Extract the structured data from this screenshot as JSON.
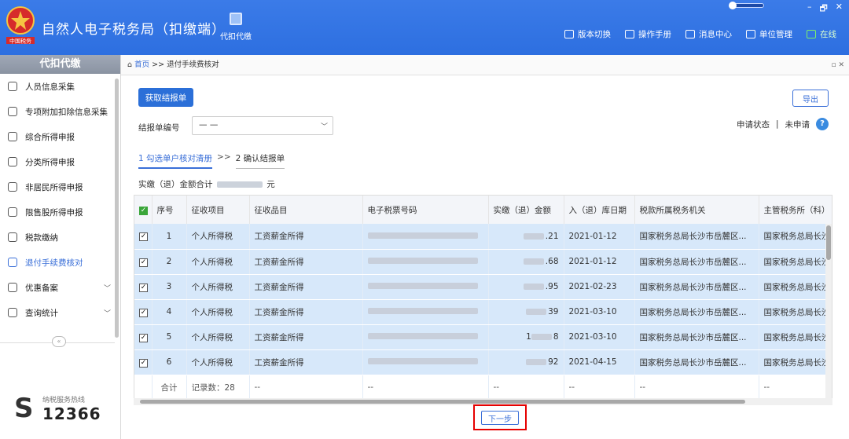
{
  "app": {
    "title": "自然人电子税务局（扣缴端）",
    "logo_text": "中国税务",
    "module_label": "代扣代缴"
  },
  "top_links": [
    {
      "name": "version-switch",
      "label": "版本切换"
    },
    {
      "name": "manual",
      "label": "操作手册"
    },
    {
      "name": "message-center",
      "label": "消息中心"
    },
    {
      "name": "unit-management",
      "label": "单位管理"
    },
    {
      "name": "online-status",
      "label": "在线"
    }
  ],
  "window_controls": {
    "minimize": "–",
    "maximize": "🗗",
    "close": "✕"
  },
  "sidebar": {
    "header": "代扣代缴",
    "items": [
      {
        "label": "人员信息采集",
        "icon": "person-icon"
      },
      {
        "label": "专项附加扣除信息采集",
        "icon": "grid-icon"
      },
      {
        "label": "综合所得申报",
        "icon": "layers-icon"
      },
      {
        "label": "分类所得申报",
        "icon": "pie-icon"
      },
      {
        "label": "非居民所得申报",
        "icon": "person-plus-icon"
      },
      {
        "label": "限售股所得申报",
        "icon": "bar-chart-icon"
      },
      {
        "label": "税款缴纳",
        "icon": "wallet-icon"
      },
      {
        "label": "退付手续费核对",
        "icon": "document-icon",
        "active": true
      },
      {
        "label": "优惠备案",
        "icon": "file-icon",
        "chevron": true
      },
      {
        "label": "查询统计",
        "icon": "query-icon",
        "chevron": true
      }
    ],
    "collapse": "«",
    "hotline": {
      "label": "纳税服务热线",
      "number": "12366"
    }
  },
  "breadcrumb": {
    "home": "首页",
    "sep": ">>",
    "current": "退付手续费核对",
    "controls": "▫ ✕"
  },
  "toolbar": {
    "fetch": "获取结报单",
    "export": "导出"
  },
  "form": {
    "report_no_label": "结报单编号",
    "report_no_value": "— —",
    "status_label": "申请状态",
    "status_sep": "|",
    "status_value": "未申请",
    "help": "?"
  },
  "steps": {
    "step1": "1 勾选单户核对清册",
    "sep": ">>",
    "step2": "2 确认结报单"
  },
  "total": {
    "label": "实缴（退）金额合计",
    "unit": "元"
  },
  "table": {
    "headers": [
      "序号",
      "征收项目",
      "征收品目",
      "电子税票号码",
      "实缴（退）金额",
      "入（退）库日期",
      "税款所属税务机关",
      "主管税务所（科）"
    ],
    "rows": [
      {
        "no": "1",
        "item": "个人所得税",
        "sub": "工资薪金所得",
        "amount_prefix": "",
        "amount": ".21",
        "date": "2021-01-12",
        "office": "国家税务总局长沙市岳麓区...",
        "branch": "国家税务总局长沙"
      },
      {
        "no": "2",
        "item": "个人所得税",
        "sub": "工资薪金所得",
        "amount_prefix": "",
        "amount": ".68",
        "date": "2021-01-12",
        "office": "国家税务总局长沙市岳麓区...",
        "branch": "国家税务总局长沙"
      },
      {
        "no": "3",
        "item": "个人所得税",
        "sub": "工资薪金所得",
        "amount_prefix": "",
        "amount": ".95",
        "date": "2021-02-23",
        "office": "国家税务总局长沙市岳麓区...",
        "branch": "国家税务总局长沙"
      },
      {
        "no": "4",
        "item": "个人所得税",
        "sub": "工资薪金所得",
        "amount_prefix": "",
        "amount": "39",
        "date": "2021-03-10",
        "office": "国家税务总局长沙市岳麓区...",
        "branch": "国家税务总局长沙"
      },
      {
        "no": "5",
        "item": "个人所得税",
        "sub": "工资薪金所得",
        "amount_prefix": "1",
        "amount": "8",
        "date": "2021-03-10",
        "office": "国家税务总局长沙市岳麓区...",
        "branch": "国家税务总局长沙"
      },
      {
        "no": "6",
        "item": "个人所得税",
        "sub": "工资薪金所得",
        "amount_prefix": "",
        "amount": "92",
        "date": "2021-04-15",
        "office": "国家税务总局长沙市岳麓区...",
        "branch": "国家税务总局长沙"
      }
    ],
    "summary": {
      "label": "合计",
      "count": "记录数：28",
      "dash": "--"
    }
  },
  "next_button": "下一步",
  "colors": {
    "brand": "#2d6fe0",
    "highlight": "#e60000",
    "row_selected": "#d7e8fa"
  }
}
